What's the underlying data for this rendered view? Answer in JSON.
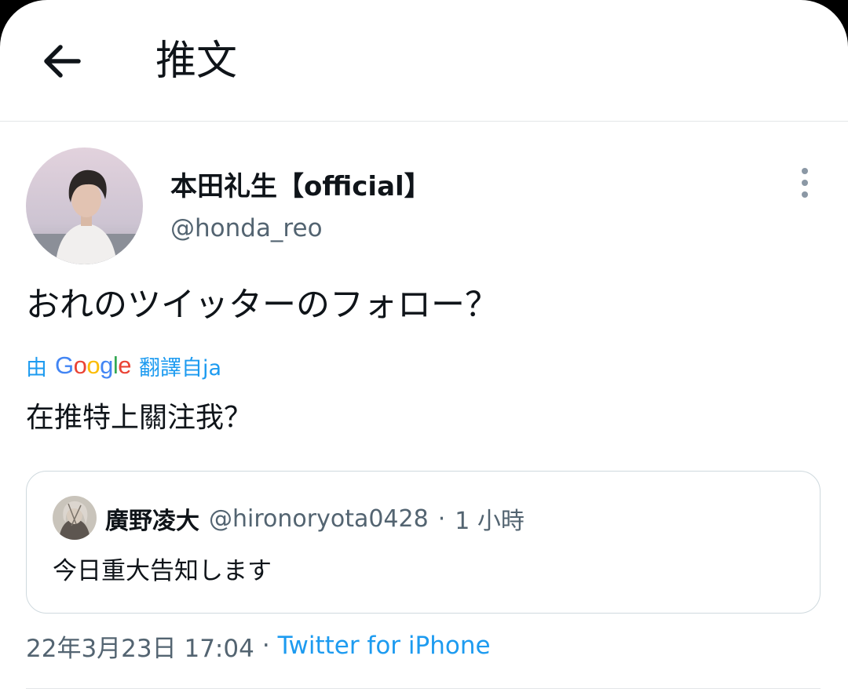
{
  "header": {
    "title": "推文",
    "back_icon": "arrow-left-icon"
  },
  "tweet": {
    "display_name": "本田礼生【official】",
    "handle": "@honda_reo",
    "text": "おれのツイッターのフォロー？",
    "translation": {
      "prefix": "由",
      "provider": "Google",
      "suffix": "翻譯自ja",
      "text": "在推特上關注我？"
    },
    "timestamp": "22年3月23日 17:04",
    "separator": "·",
    "source": "Twitter for iPhone"
  },
  "quoted_tweet": {
    "display_name": "廣野凌大",
    "handle": "@hironoryota0428",
    "separator": "·",
    "time": "1 小時",
    "text": "今日重大告知します"
  },
  "colors": {
    "accent": "#1d9bf0",
    "text_primary": "#0f1419",
    "text_secondary": "#536471",
    "border": "#cfd9de",
    "google_blue": "#4285F4",
    "google_red": "#EA4335",
    "google_yellow": "#FBBC05",
    "google_green": "#34A853"
  }
}
